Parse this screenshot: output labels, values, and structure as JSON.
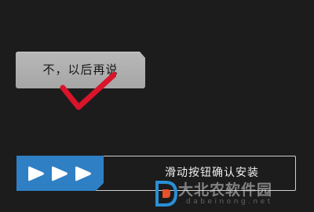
{
  "dialog": {
    "later_button_label": "不，以后再说"
  },
  "slider": {
    "label": "滑动按钮确认安装",
    "handle_icon": "triple-play-arrow-icon",
    "accent_color": "#2f7fc4"
  },
  "annotation": {
    "icon": "red-check-mark",
    "color": "#d9142b"
  },
  "watermark": {
    "title": "大北农软件园",
    "url": "dabeinong.net"
  }
}
